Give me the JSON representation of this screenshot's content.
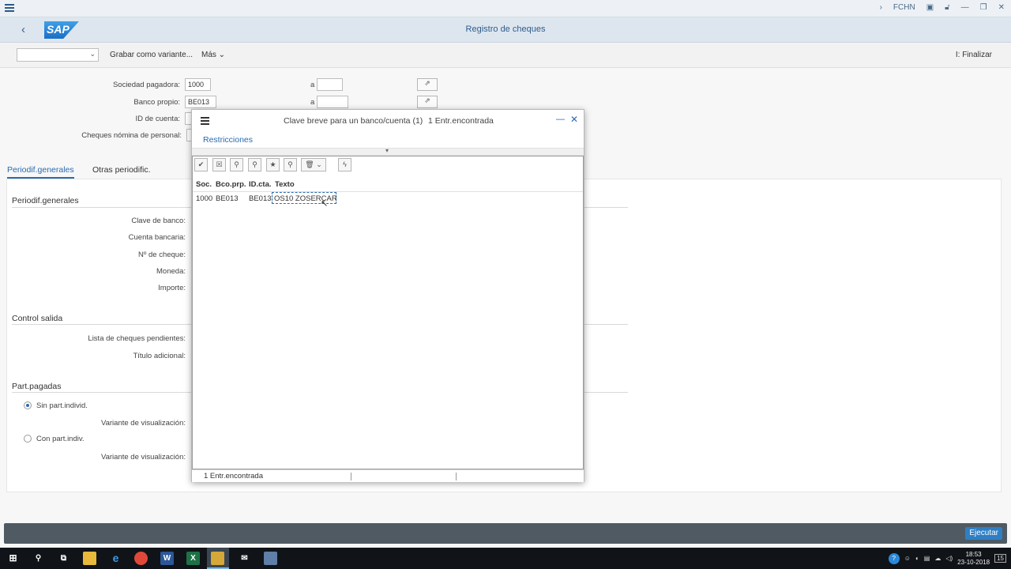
{
  "system": {
    "user_label": "FCHN"
  },
  "shell": {
    "title": "Registro de cheques",
    "logo_text": "SAP"
  },
  "toolbar": {
    "variant_value": "",
    "save_variant": "Grabar como variante...",
    "more": "Más",
    "finish": "Finalizar"
  },
  "selection": {
    "rows": [
      {
        "label": "Sociedad pagadora:",
        "value": "1000",
        "to_label": "a",
        "to_value": ""
      },
      {
        "label": "Banco propio:",
        "value": "BE013",
        "to_label": "a",
        "to_value": ""
      },
      {
        "label": "ID de cuenta:",
        "value": ""
      },
      {
        "label": "Cheques nómina de personal:",
        "value": ""
      }
    ]
  },
  "tabs": [
    {
      "label": "Periodif.generales"
    },
    {
      "label": "Otras periodific."
    }
  ],
  "sections": {
    "general": {
      "title": "Periodif.generales",
      "fields": [
        "Clave de banco:",
        "Cuenta bancaria:",
        "Nº de cheque:",
        "Moneda:",
        "Importe:"
      ]
    },
    "output": {
      "title": "Control salida",
      "fields": [
        "Lista de cheques pendientes:",
        "Título adicional:"
      ]
    },
    "paid": {
      "title": "Part.pagadas",
      "radio1": "Sin part.individ.",
      "field1": "Variante de visualización:",
      "radio2": "Con part.indiv.",
      "field2": "Variante de visualización:"
    }
  },
  "footer": {
    "execute": "Ejecutar"
  },
  "dialog": {
    "title": "Clave breve para un banco/cuenta (1)",
    "count": "1 Entr.encontrada",
    "restrictions": "Restricciones",
    "columns": [
      "Soc.",
      "Bco.prp.",
      "ID.cta.",
      "Texto"
    ],
    "rows": [
      {
        "soc": "1000",
        "bank": "BE013",
        "acct": "BE013",
        "text": "OS10 ZOSERCAR"
      }
    ],
    "status": "1 Entr.encontrada"
  },
  "taskbar": {
    "time": "18:53",
    "date": "23-10-2018",
    "notifications": "15"
  }
}
